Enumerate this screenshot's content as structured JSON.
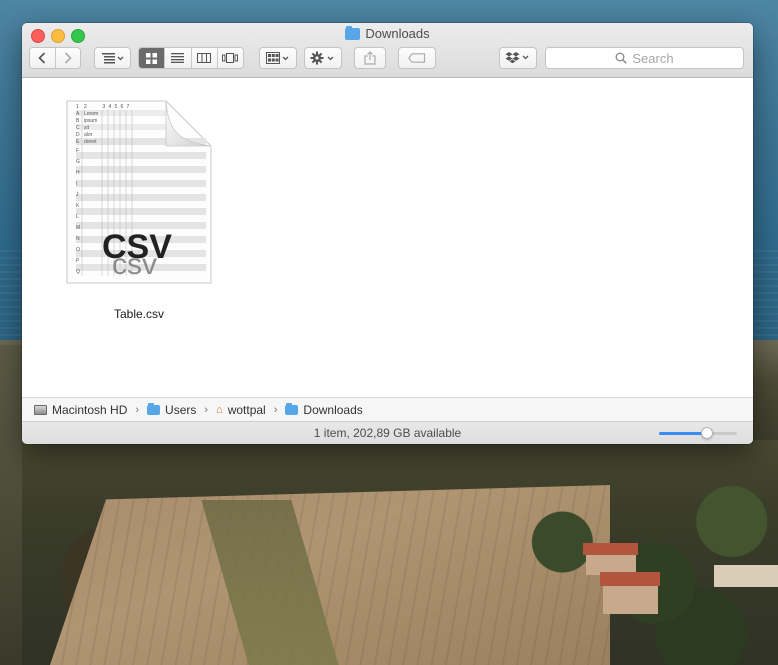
{
  "window": {
    "title": "Downloads",
    "title_icon": "folder-icon"
  },
  "toolbar": {
    "back_icon": "chevron-left-icon",
    "forward_icon": "chevron-right-icon",
    "arrange_icon": "list-arrange-icon",
    "view_modes": [
      {
        "name": "icon-view",
        "active": true
      },
      {
        "name": "list-view",
        "active": false
      },
      {
        "name": "column-view",
        "active": false
      },
      {
        "name": "cover-flow-view",
        "active": false
      }
    ],
    "group_icon": "group-grid-icon",
    "action_icon": "gear-icon",
    "share_icon": "share-icon",
    "tag_icon": "tag-icon",
    "dropbox_icon": "dropbox-icon",
    "search_placeholder": "Search"
  },
  "files": [
    {
      "name": "Table.csv",
      "icon_text": "CSV",
      "icon_text_lower": "csv",
      "type": "csv-file-icon"
    }
  ],
  "csv_preview": {
    "col_numbers": [
      "1",
      "2",
      "3",
      "4",
      "5",
      "6",
      "7"
    ],
    "row_letters": [
      "A",
      "B",
      "C",
      "D",
      "E",
      "F",
      "G",
      "H",
      "I",
      "J",
      "K",
      "L",
      "M",
      "N",
      "O",
      "P",
      "Q"
    ],
    "cells": [
      "Lorem",
      "ipsum",
      "sit",
      "alor",
      "donet"
    ]
  },
  "path_bar": {
    "crumbs": [
      {
        "label": "Macintosh HD",
        "icon": "hard-drive-icon"
      },
      {
        "label": "Users",
        "icon": "folder-icon"
      },
      {
        "label": "wottpal",
        "icon": "home-icon"
      },
      {
        "label": "Downloads",
        "icon": "folder-icon"
      }
    ]
  },
  "status_bar": {
    "text": "1 item, 202,89 GB available",
    "icon_size_fraction": 0.62
  },
  "colors": {
    "accent": "#3b8df5",
    "folder": "#57a7e8",
    "close": "#fc605c",
    "minimize": "#fdbc40",
    "maximize": "#34c84a"
  }
}
